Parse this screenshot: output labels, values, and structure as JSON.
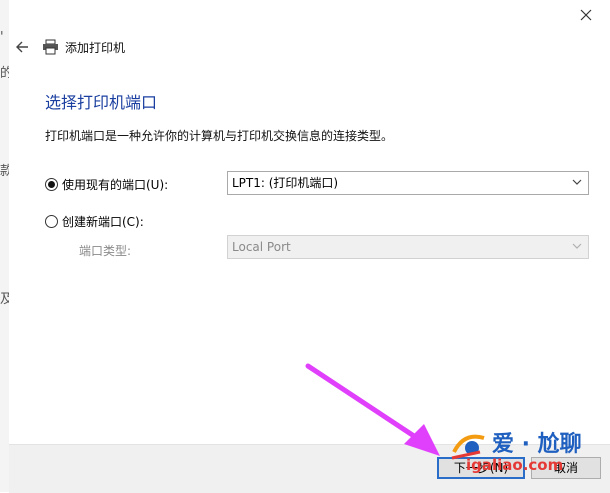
{
  "background": {
    "fragments": [
      "'",
      "的",
      "款",
      "及"
    ]
  },
  "dialog": {
    "title": "添加打印机",
    "heading": "选择打印机端口",
    "description": "打印机端口是一种允许你的计算机与打印机交换信息的连接类型。",
    "use_existing": {
      "label": "使用现有的端口(U):",
      "checked": true,
      "selected_value": "LPT1: (打印机端口)"
    },
    "create_new": {
      "label": "创建新端口(C):",
      "checked": false,
      "port_type_label": "端口类型:",
      "port_type_value": "Local Port"
    },
    "footer": {
      "next_label": "下一步(N)",
      "cancel_label": "取消"
    }
  },
  "watermark": {
    "brand": "爱 · 尬聊",
    "url": "igaliao.com"
  },
  "colors": {
    "heading": "#1b3fa0",
    "arrow": "#e040fb",
    "focus": "#2a6dc9",
    "watermark_blue": "#1f5fbf",
    "watermark_red": "#e53935"
  }
}
